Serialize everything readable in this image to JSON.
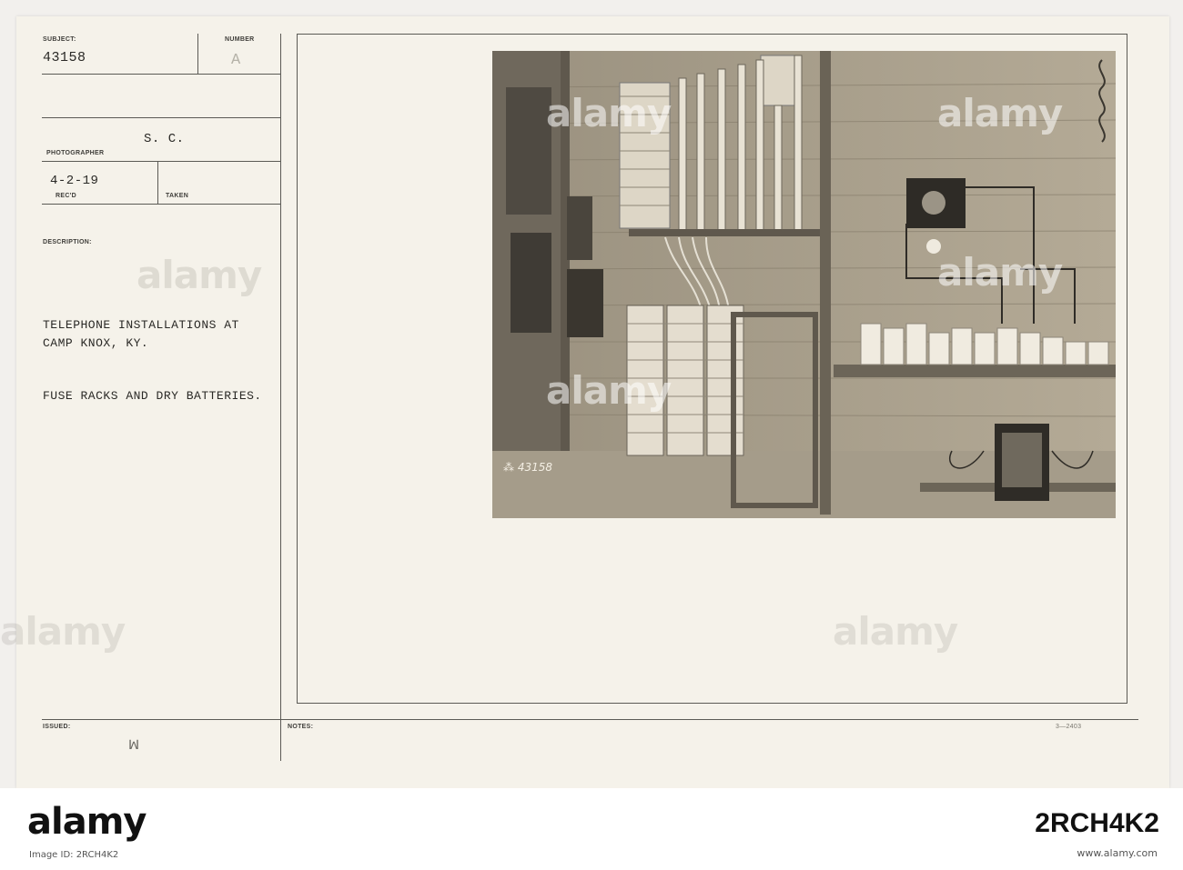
{
  "card": {
    "subject_label": "SUBJECT:",
    "subject_value": "43158",
    "number_label": "NUMBER",
    "number_value": "A",
    "photographer_label": "PHOTOGRAPHER",
    "photographer_value": "S. C.",
    "recd_value": "4-2-19",
    "recd_label": "REC'D",
    "taken_label": "TAKEN",
    "description_label": "DESCRIPTION:",
    "description_lines": [
      "TELEPHONE INSTALLATIONS AT",
      "CAMP KNOX, KY.",
      "FUSE RACKS AND DRY BATTERIES."
    ],
    "issued_label": "ISSUED:",
    "issued_mark": "ꟽ",
    "notes_label": "NOTES:",
    "form_code": "3—2403"
  },
  "photo": {
    "negative_number": "43158",
    "negative_symbol": "⁂"
  },
  "watermark": {
    "brand": "alamy",
    "image_id": "2RCH4K2",
    "caption": "Image ID: 2RCH4K2",
    "url": "www.alamy.com"
  }
}
